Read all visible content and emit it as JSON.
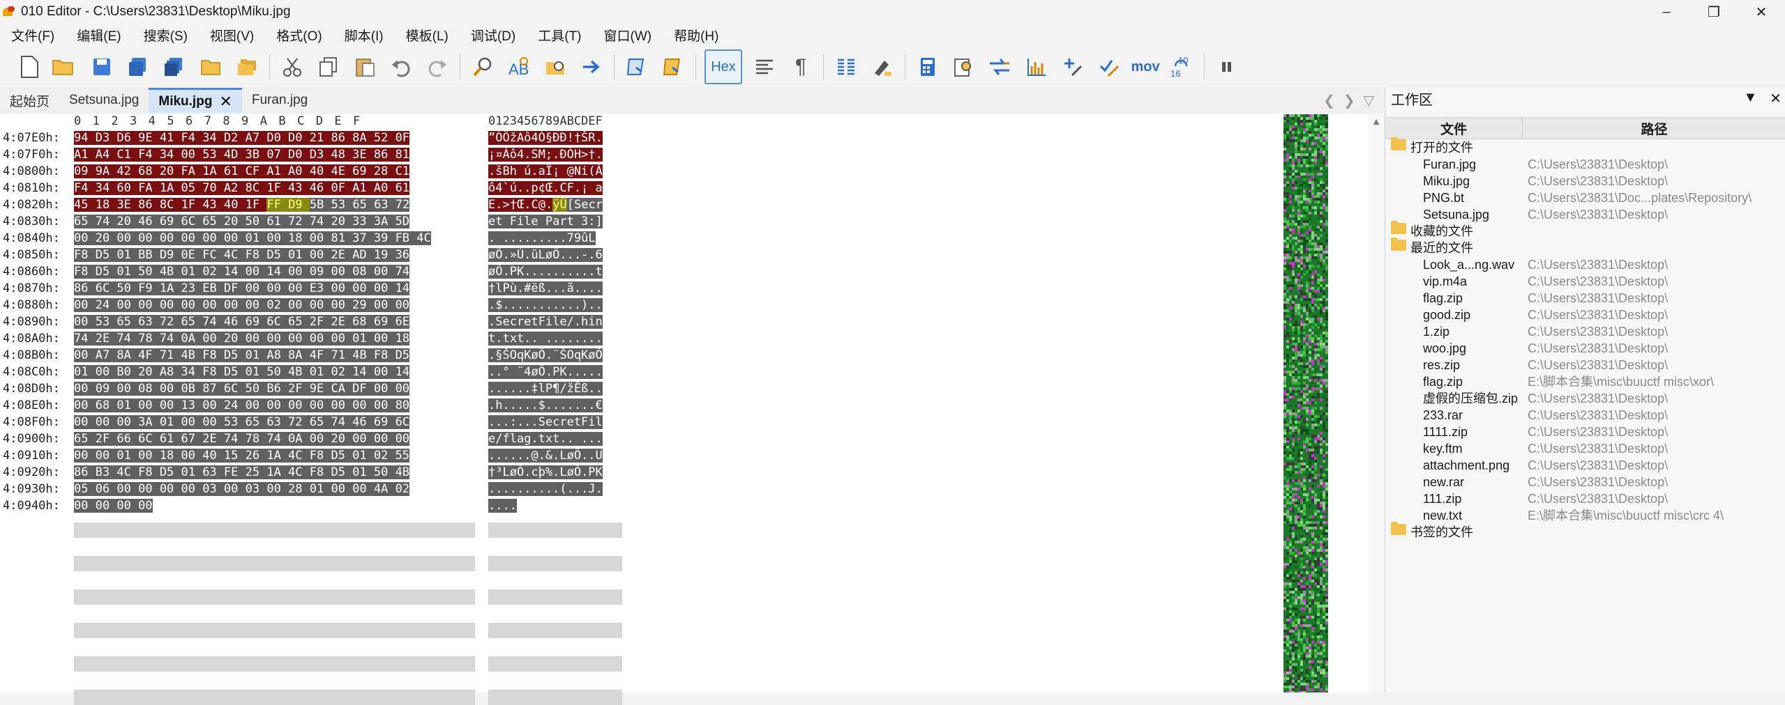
{
  "window": {
    "title": "010 Editor - C:\\Users\\23831\\Desktop\\Miku.jpg",
    "min_icon": "minimize-icon",
    "max_icon": "maximize-icon",
    "close_icon": "close-icon"
  },
  "menu": [
    "文件(F)",
    "编辑(E)",
    "搜索(S)",
    "视图(V)",
    "格式(O)",
    "脚本(I)",
    "模板(L)",
    "调试(D)",
    "工具(T)",
    "窗口(W)",
    "帮助(H)"
  ],
  "toolbar": {
    "hex_label": "Hex",
    "mov_label": "mov",
    "base_label": "10\n16",
    "pilcrow": "¶"
  },
  "tabs": [
    {
      "label": "起始页",
      "active": false
    },
    {
      "label": "Setsuna.jpg",
      "active": false
    },
    {
      "label": "Miku.jpg",
      "active": true
    },
    {
      "label": "Furan.jpg",
      "active": false
    }
  ],
  "editor": {
    "hex_header": "0 1 2 3 4 5 6 7 8 9 A B C D E F",
    "text_header": "0123456789ABCDEF",
    "rows": [
      {
        "addr": "4:07E0h:",
        "hex": "94 D3 D6 9E 41 F4 34 D2 A7 D0 D0 21 86 8A 52 0F",
        "text": "”ÓÖžAô4Ò§ÐÐ!†ŠR.",
        "style": "red"
      },
      {
        "addr": "4:07F0h:",
        "hex": "A1 A4 C1 F4 34 00 53 4D 3B 07 D0 D3 48 3E 86 81",
        "text": "¡¤Áô4.SM;.ÐÓH>†.",
        "style": "red"
      },
      {
        "addr": "4:0800h:",
        "hex": "09 9A 42 68 20 FA 1A 61 CF A1 A0 40 4E 69 28 C1",
        "text": ".šBh ú.aÏ¡ @Ni(Á",
        "style": "red"
      },
      {
        "addr": "4:0810h:",
        "hex": "F4 34 60 FA 1A 05 70 A2 8C 1F 43 46 0F A1 A0 61",
        "text": "ô4`ú..p¢Œ.CF.¡ a",
        "style": "red"
      },
      {
        "addr": "4:0820h:",
        "hex": "45 18 3E 86 8C 1F 43 40 1F FF D9 5B 53 65 63 72",
        "text": "E.>†Œ.C@.ÿÙ[Secr",
        "style": "mixed"
      },
      {
        "addr": "4:0830h:",
        "hex": "65 74 20 46 69 6C 65 20 50 61 72 74 20 33 3A 5D",
        "text": "et File Part 3:]",
        "style": "grey"
      },
      {
        "addr": "4:0840h:",
        "hex": "00 20 00 00 00 00 00 00 01 00 18 00 81 37 39 FB 4C",
        "text": ". .........79ûL",
        "style": "grey"
      },
      {
        "addr": "4:0850h:",
        "hex": "F8 D5 01 BB D9 0E FC 4C F8 D5 01 00 2E AD 19 36",
        "text": "øÕ.»Ù.üLøÕ...-.6",
        "style": "grey"
      },
      {
        "addr": "4:0860h:",
        "hex": "F8 D5 01 50 4B 01 02 14 00 14 00 09 00 08 00 74",
        "text": "øÕ.PK..........t",
        "style": "grey"
      },
      {
        "addr": "4:0870h:",
        "hex": "86 6C 50 F9 1A 23 EB DF 00 00 00 E3 00 00 00 14",
        "text": "†lPù.#ëß...ã....",
        "style": "grey"
      },
      {
        "addr": "4:0880h:",
        "hex": "00 24 00 00 00 00 00 00 00 02 00 00 00 29 00 00",
        "text": ".$...........)..",
        "style": "grey"
      },
      {
        "addr": "4:0890h:",
        "hex": "00 53 65 63 72 65 74 46 69 6C 65 2F 2E 68 69 6E",
        "text": ".SecretFile/.hin",
        "style": "grey"
      },
      {
        "addr": "4:08A0h:",
        "hex": "74 2E 74 78 74 0A 00 20 00 00 00 00 00 01 00 18",
        "text": "t.txt.. ........",
        "style": "grey"
      },
      {
        "addr": "4:08B0h:",
        "hex": "00 A7 8A 4F 71 4B F8 D5 01 A8 8A 4F 71 4B F8 D5",
        "text": ".§ŠOqKøÕ.¨ŠOqKøÕ",
        "style": "grey"
      },
      {
        "addr": "4:08C0h:",
        "hex": "01 00 B0 20 A8 34 F8 D5 01 50 4B 01 02 14 00 14",
        "text": "..° ¨4øÕ.PK.....",
        "style": "grey"
      },
      {
        "addr": "4:08D0h:",
        "hex": "00 09 00 08 00 0B 87 6C 50 B6 2F 9E CA DF 00 00",
        "text": "......‡lP¶/žÊß..",
        "style": "grey"
      },
      {
        "addr": "4:08E0h:",
        "hex": "00 68 01 00 00 13 00 24 00 00 00 00 00 00 00 80",
        "text": ".h.....$.......€",
        "style": "grey"
      },
      {
        "addr": "4:08F0h:",
        "hex": "00 00 00 3A 01 00 00 53 65 63 72 65 74 46 69 6C",
        "text": "...:...SecretFil",
        "style": "grey"
      },
      {
        "addr": "4:0900h:",
        "hex": "65 2F 66 6C 61 67 2E 74 78 74 0A 00 20 00 00 00",
        "text": "e/flag.txt.. ...",
        "style": "grey"
      },
      {
        "addr": "4:0910h:",
        "hex": "00 00 01 00 18 00 40 15 26 1A 4C F8 D5 01 02 55",
        "text": "......@.&.LøÕ..U",
        "style": "grey"
      },
      {
        "addr": "4:0920h:",
        "hex": "86 B3 4C F8 D5 01 63 FE 25 1A 4C F8 D5 01 50 4B",
        "text": "†³LøÕ.cþ%.LøÕ.PK",
        "style": "grey"
      },
      {
        "addr": "4:0930h:",
        "hex": "05 06 00 00 00 00 03 00 03 00 28 01 00 00 4A 02",
        "text": "..........(...J.",
        "style": "grey"
      },
      {
        "addr": "4:0940h:",
        "hex": "00 00 00 00",
        "text": "....",
        "style": "grey"
      }
    ]
  },
  "workspace": {
    "title": "工作区",
    "col_file": "文件",
    "col_path": "路径",
    "groups": [
      {
        "label": "打开的文件",
        "items": [
          {
            "name": "Furan.jpg",
            "path": "C:\\Users\\23831\\Desktop\\"
          },
          {
            "name": "Miku.jpg",
            "path": "C:\\Users\\23831\\Desktop\\"
          },
          {
            "name": "PNG.bt",
            "path": "C:\\Users\\23831\\Doc...plates\\Repository\\"
          },
          {
            "name": "Setsuna.jpg",
            "path": "C:\\Users\\23831\\Desktop\\"
          }
        ]
      },
      {
        "label": "收藏的文件",
        "items": []
      },
      {
        "label": "最近的文件",
        "items": [
          {
            "name": "Look_a...ng.wav",
            "path": "C:\\Users\\23831\\Desktop\\"
          },
          {
            "name": "vip.m4a",
            "path": "C:\\Users\\23831\\Desktop\\"
          },
          {
            "name": "flag.zip",
            "path": "C:\\Users\\23831\\Desktop\\"
          },
          {
            "name": "good.zip",
            "path": "C:\\Users\\23831\\Desktop\\"
          },
          {
            "name": "1.zip",
            "path": "C:\\Users\\23831\\Desktop\\"
          },
          {
            "name": "woo.jpg",
            "path": "C:\\Users\\23831\\Desktop\\"
          },
          {
            "name": "res.zip",
            "path": "C:\\Users\\23831\\Desktop\\"
          },
          {
            "name": "flag.zip",
            "path": "E:\\脚本合集\\misc\\buuctf misc\\xor\\"
          },
          {
            "name": "虚假的压缩包.zip",
            "path": "C:\\Users\\23831\\Desktop\\"
          },
          {
            "name": "233.rar",
            "path": "C:\\Users\\23831\\Desktop\\"
          },
          {
            "name": "1111.zip",
            "path": "C:\\Users\\23831\\Desktop\\"
          },
          {
            "name": "key.ftm",
            "path": "C:\\Users\\23831\\Desktop\\"
          },
          {
            "name": "attachment.png",
            "path": "C:\\Users\\23831\\Desktop\\"
          },
          {
            "name": "new.rar",
            "path": "C:\\Users\\23831\\Desktop\\"
          },
          {
            "name": "111.zip",
            "path": "C:\\Users\\23831\\Desktop\\"
          },
          {
            "name": "new.txt",
            "path": "E:\\脚本合集\\misc\\buuctf misc\\crc 4\\"
          }
        ]
      },
      {
        "label": "书签的文件",
        "items": []
      }
    ]
  }
}
